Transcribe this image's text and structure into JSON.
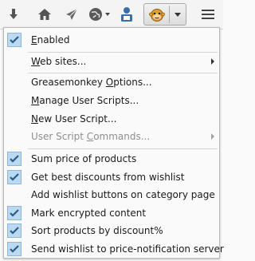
{
  "toolbar": {
    "icons": [
      "download-arrow-icon",
      "home-icon",
      "send-icon",
      "globe-icon",
      "user-badge-icon",
      "greasemonkey-icon",
      "dropdown-icon",
      "hamburger-menu-icon"
    ]
  },
  "menu": {
    "enabled": {
      "pre": "",
      "u": "E",
      "post": "nabled",
      "checked": true
    },
    "web_sites": {
      "pre": "",
      "u": "W",
      "post": "eb sites..."
    },
    "gm_options": {
      "pre": "Greasemonkey ",
      "u": "O",
      "post": "ptions..."
    },
    "manage": {
      "pre": "",
      "u": "M",
      "post": "anage User Scripts..."
    },
    "new_script": {
      "pre": "",
      "u": "N",
      "post": "ew User Script..."
    },
    "commands": {
      "pre": "User Script ",
      "u": "C",
      "post": "ommands..."
    },
    "scripts": [
      {
        "label": "Sum price of products",
        "checked": true
      },
      {
        "label": "Get best discounts from wishlist",
        "checked": true
      },
      {
        "label": "Add wishlist buttons on category page",
        "checked": false
      },
      {
        "label": "Mark encrypted content",
        "checked": true
      },
      {
        "label": "Sort products by discount%",
        "checked": true
      },
      {
        "label": "Send wishlist to price-notification server",
        "checked": true
      }
    ]
  },
  "colors": {
    "check_bg": "#bcd9f2",
    "check_border": "#8db6dc",
    "check_mark": "#2a5b8a"
  }
}
